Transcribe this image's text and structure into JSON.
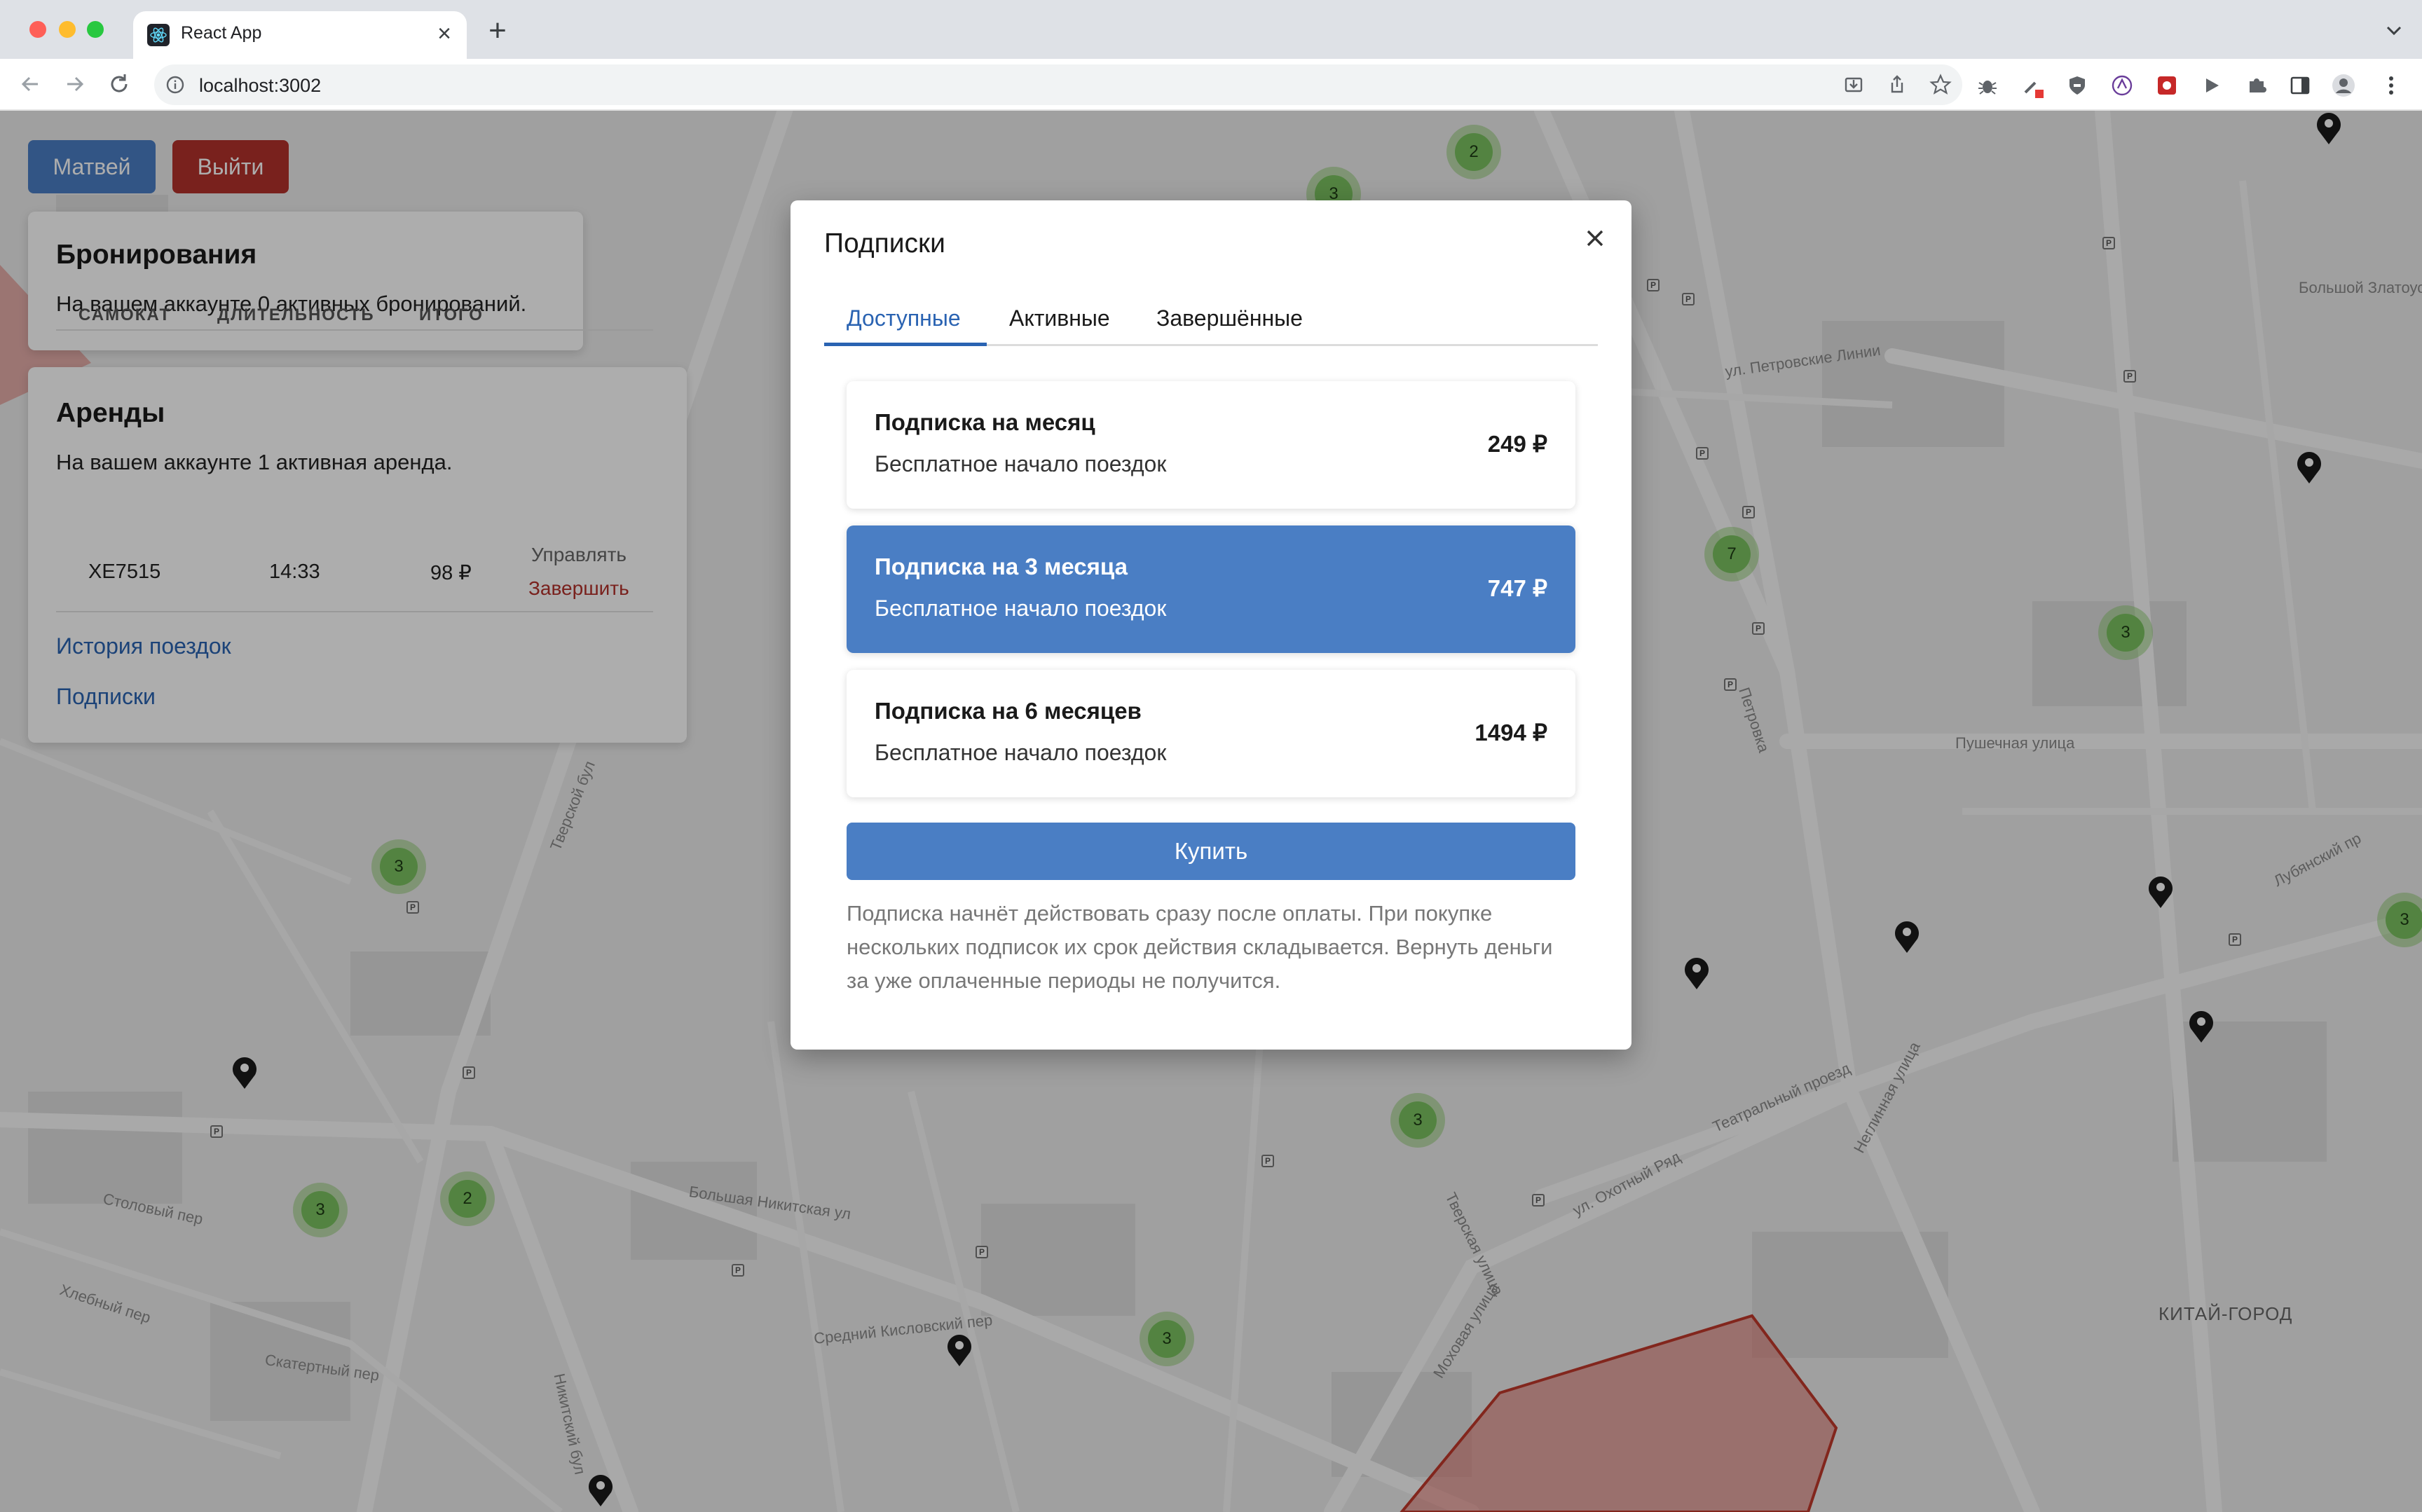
{
  "browser": {
    "tab_title": "React App",
    "url": "localhost:3002"
  },
  "header": {
    "user_button": "Матвей",
    "logout_button": "Выйти"
  },
  "bookings": {
    "title": "Бронирования",
    "text": "На вашем аккаунте 0 активных бронирований."
  },
  "rentals": {
    "title": "Аренды",
    "text": "На вашем аккаунте 1 активная аренда.",
    "columns": [
      "САМОКАТ",
      "ДЛИТЕЛЬНОСТЬ",
      "ИТОГО"
    ],
    "rows": [
      {
        "scooter": "XE7515",
        "duration": "14:33",
        "total": "98 ₽",
        "manage": "Управлять",
        "finish": "Завершить"
      }
    ],
    "history_link": "История поездок",
    "subscriptions_link": "Подписки"
  },
  "modal": {
    "title": "Подписки",
    "tabs": [
      "Доступные",
      "Активные",
      "Завершённые"
    ],
    "active_tab": "Доступные",
    "plans": [
      {
        "name": "Подписка на месяц",
        "description": "Бесплатное начало поездок",
        "price": "249 ₽",
        "selected": false
      },
      {
        "name": "Подписка на 3 месяца",
        "description": "Бесплатное начало поездок",
        "price": "747 ₽",
        "selected": true
      },
      {
        "name": "Подписка на 6 месяцев",
        "description": "Бесплатное начало поездок",
        "price": "1494 ₽",
        "selected": false
      }
    ],
    "buy_button": "Купить",
    "note": "Подписка начнёт действовать сразу после оплаты. При покупке нескольких подписок их срок действия складывается. Вернуть деньги за уже оплаченные периоды не получится."
  },
  "map": {
    "street_labels": [
      "Тверской бул",
      "Большая Никитская ул",
      "Никитский бул",
      "Моховая улица",
      "ул. Охотный Ряд",
      "Театральный проезд",
      "Лубянский пр",
      "Пушечная улица",
      "ул. Петровские Линии",
      "Неглинная улица",
      "Средний Кисловский пер",
      "Скатертный пер",
      "Столовый пер",
      "Хлебный пер",
      "Тверская улица",
      "Большой Златоустинский пер",
      "Петровка"
    ],
    "district": "КИТАЙ-ГОРОД",
    "clusters": [
      "2",
      "3",
      "7",
      "3",
      "3",
      "2",
      "3",
      "3",
      "3",
      "3"
    ],
    "accent_colors": {
      "primary": "#4a7ec4",
      "danger": "#b3312b",
      "cluster": "#7bc260"
    }
  }
}
